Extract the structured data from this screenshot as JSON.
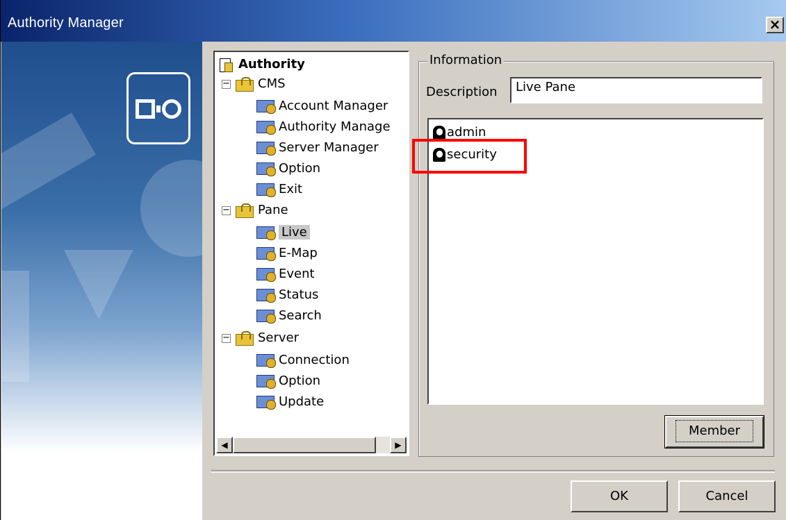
{
  "window": {
    "title": "Authority Manager",
    "close_label": "×"
  },
  "tree": {
    "root_label": "Authority",
    "groups": [
      {
        "label": "CMS",
        "items": [
          "Account Manager",
          "Authority Manage",
          "Server Manager",
          "Option",
          "Exit"
        ]
      },
      {
        "label": "Pane",
        "items": [
          "Live",
          "E-Map",
          "Event",
          "Status",
          "Search"
        ]
      },
      {
        "label": "Server",
        "items": [
          "Connection",
          "Option",
          "Update"
        ]
      }
    ],
    "selected_item": "Live",
    "expander_symbol": "−",
    "scroll_left": "◀",
    "scroll_right": "▶"
  },
  "info": {
    "legend": "Information",
    "description_label": "Description",
    "description_value": "Live Pane",
    "members": [
      "admin",
      "security"
    ],
    "member_button": "Member"
  },
  "buttons": {
    "ok": "OK",
    "cancel": "Cancel"
  },
  "colors": {
    "highlight": "#ff0000",
    "title_start": "#0a246a",
    "title_end": "#a6caf0"
  },
  "icons": {
    "close": "close-icon",
    "folder": "folder-lock-icon",
    "item": "module-icon",
    "root": "document-lock-icon",
    "user": "user-icon"
  }
}
